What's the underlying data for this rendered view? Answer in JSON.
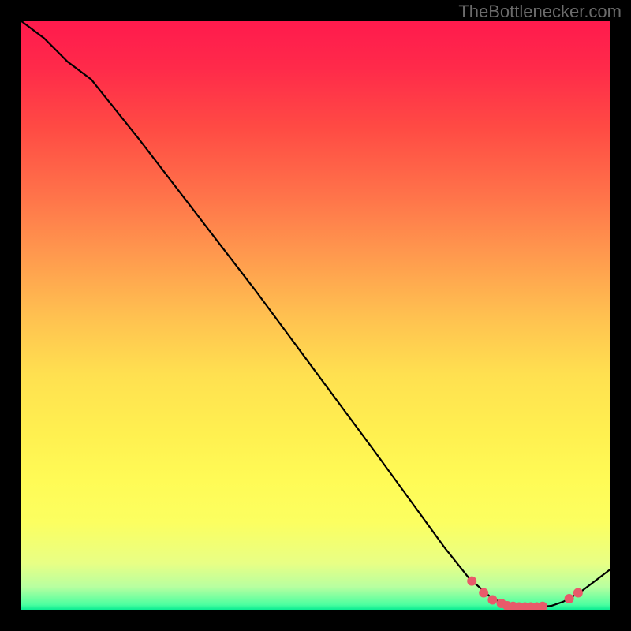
{
  "watermark": "TheBottlenecker.com",
  "chart_data": {
    "type": "line",
    "title": "",
    "xlabel": "",
    "ylabel": "",
    "xlim": [
      0,
      100
    ],
    "ylim": [
      0,
      100
    ],
    "series": [
      {
        "name": "curve",
        "x": [
          0,
          4,
          8,
          12,
          20,
          30,
          40,
          50,
          60,
          68,
          72,
          76,
          80,
          82,
          84,
          86,
          88,
          90,
          92,
          95,
          100
        ],
        "values": [
          100,
          97,
          93,
          90,
          80,
          67,
          54,
          40.5,
          27,
          16,
          10.5,
          5.5,
          2,
          1.2,
          0.8,
          0.6,
          0.6,
          0.8,
          1.5,
          3.2,
          7
        ]
      }
    ],
    "markers": [
      {
        "x": 76.5,
        "y": 5.0
      },
      {
        "x": 78.5,
        "y": 3.0
      },
      {
        "x": 80.0,
        "y": 1.8
      },
      {
        "x": 81.5,
        "y": 1.2
      },
      {
        "x": 82.5,
        "y": 0.8
      },
      {
        "x": 83.5,
        "y": 0.7
      },
      {
        "x": 84.5,
        "y": 0.6
      },
      {
        "x": 85.5,
        "y": 0.6
      },
      {
        "x": 86.5,
        "y": 0.6
      },
      {
        "x": 87.5,
        "y": 0.6
      },
      {
        "x": 88.5,
        "y": 0.7
      },
      {
        "x": 93.0,
        "y": 2.0
      },
      {
        "x": 94.5,
        "y": 3.0
      }
    ],
    "gradient_stops": [
      {
        "pos": 0,
        "color": "#ff1a4d"
      },
      {
        "pos": 50,
        "color": "#ffe050"
      },
      {
        "pos": 85,
        "color": "#fcff60"
      },
      {
        "pos": 100,
        "color": "#00e890"
      }
    ]
  }
}
